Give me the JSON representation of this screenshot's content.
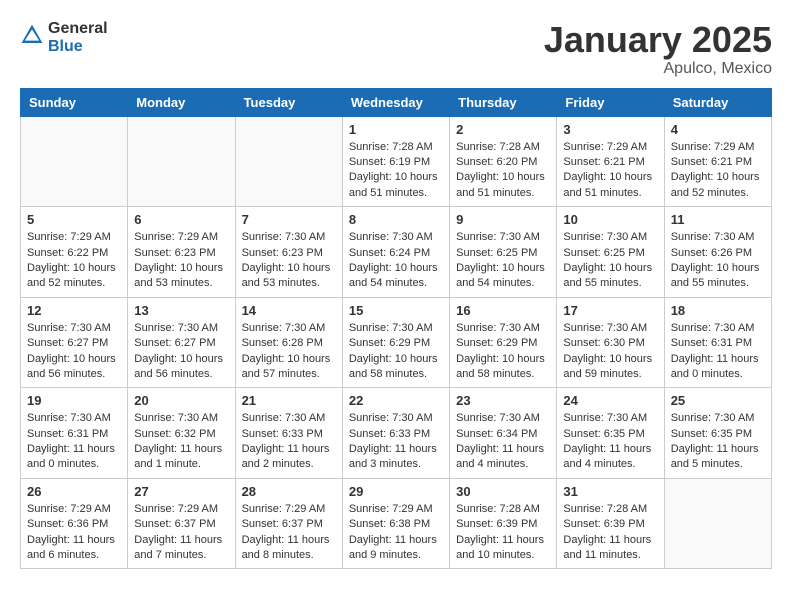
{
  "header": {
    "logo_general": "General",
    "logo_blue": "Blue",
    "title": "January 2025",
    "subtitle": "Apulco, Mexico"
  },
  "days_of_week": [
    "Sunday",
    "Monday",
    "Tuesday",
    "Wednesday",
    "Thursday",
    "Friday",
    "Saturday"
  ],
  "weeks": [
    [
      {
        "day": "",
        "sunrise": "",
        "sunset": "",
        "daylight": ""
      },
      {
        "day": "",
        "sunrise": "",
        "sunset": "",
        "daylight": ""
      },
      {
        "day": "",
        "sunrise": "",
        "sunset": "",
        "daylight": ""
      },
      {
        "day": "1",
        "sunrise": "Sunrise: 7:28 AM",
        "sunset": "Sunset: 6:19 PM",
        "daylight": "Daylight: 10 hours and 51 minutes."
      },
      {
        "day": "2",
        "sunrise": "Sunrise: 7:28 AM",
        "sunset": "Sunset: 6:20 PM",
        "daylight": "Daylight: 10 hours and 51 minutes."
      },
      {
        "day": "3",
        "sunrise": "Sunrise: 7:29 AM",
        "sunset": "Sunset: 6:21 PM",
        "daylight": "Daylight: 10 hours and 51 minutes."
      },
      {
        "day": "4",
        "sunrise": "Sunrise: 7:29 AM",
        "sunset": "Sunset: 6:21 PM",
        "daylight": "Daylight: 10 hours and 52 minutes."
      }
    ],
    [
      {
        "day": "5",
        "sunrise": "Sunrise: 7:29 AM",
        "sunset": "Sunset: 6:22 PM",
        "daylight": "Daylight: 10 hours and 52 minutes."
      },
      {
        "day": "6",
        "sunrise": "Sunrise: 7:29 AM",
        "sunset": "Sunset: 6:23 PM",
        "daylight": "Daylight: 10 hours and 53 minutes."
      },
      {
        "day": "7",
        "sunrise": "Sunrise: 7:30 AM",
        "sunset": "Sunset: 6:23 PM",
        "daylight": "Daylight: 10 hours and 53 minutes."
      },
      {
        "day": "8",
        "sunrise": "Sunrise: 7:30 AM",
        "sunset": "Sunset: 6:24 PM",
        "daylight": "Daylight: 10 hours and 54 minutes."
      },
      {
        "day": "9",
        "sunrise": "Sunrise: 7:30 AM",
        "sunset": "Sunset: 6:25 PM",
        "daylight": "Daylight: 10 hours and 54 minutes."
      },
      {
        "day": "10",
        "sunrise": "Sunrise: 7:30 AM",
        "sunset": "Sunset: 6:25 PM",
        "daylight": "Daylight: 10 hours and 55 minutes."
      },
      {
        "day": "11",
        "sunrise": "Sunrise: 7:30 AM",
        "sunset": "Sunset: 6:26 PM",
        "daylight": "Daylight: 10 hours and 55 minutes."
      }
    ],
    [
      {
        "day": "12",
        "sunrise": "Sunrise: 7:30 AM",
        "sunset": "Sunset: 6:27 PM",
        "daylight": "Daylight: 10 hours and 56 minutes."
      },
      {
        "day": "13",
        "sunrise": "Sunrise: 7:30 AM",
        "sunset": "Sunset: 6:27 PM",
        "daylight": "Daylight: 10 hours and 56 minutes."
      },
      {
        "day": "14",
        "sunrise": "Sunrise: 7:30 AM",
        "sunset": "Sunset: 6:28 PM",
        "daylight": "Daylight: 10 hours and 57 minutes."
      },
      {
        "day": "15",
        "sunrise": "Sunrise: 7:30 AM",
        "sunset": "Sunset: 6:29 PM",
        "daylight": "Daylight: 10 hours and 58 minutes."
      },
      {
        "day": "16",
        "sunrise": "Sunrise: 7:30 AM",
        "sunset": "Sunset: 6:29 PM",
        "daylight": "Daylight: 10 hours and 58 minutes."
      },
      {
        "day": "17",
        "sunrise": "Sunrise: 7:30 AM",
        "sunset": "Sunset: 6:30 PM",
        "daylight": "Daylight: 10 hours and 59 minutes."
      },
      {
        "day": "18",
        "sunrise": "Sunrise: 7:30 AM",
        "sunset": "Sunset: 6:31 PM",
        "daylight": "Daylight: 11 hours and 0 minutes."
      }
    ],
    [
      {
        "day": "19",
        "sunrise": "Sunrise: 7:30 AM",
        "sunset": "Sunset: 6:31 PM",
        "daylight": "Daylight: 11 hours and 0 minutes."
      },
      {
        "day": "20",
        "sunrise": "Sunrise: 7:30 AM",
        "sunset": "Sunset: 6:32 PM",
        "daylight": "Daylight: 11 hours and 1 minute."
      },
      {
        "day": "21",
        "sunrise": "Sunrise: 7:30 AM",
        "sunset": "Sunset: 6:33 PM",
        "daylight": "Daylight: 11 hours and 2 minutes."
      },
      {
        "day": "22",
        "sunrise": "Sunrise: 7:30 AM",
        "sunset": "Sunset: 6:33 PM",
        "daylight": "Daylight: 11 hours and 3 minutes."
      },
      {
        "day": "23",
        "sunrise": "Sunrise: 7:30 AM",
        "sunset": "Sunset: 6:34 PM",
        "daylight": "Daylight: 11 hours and 4 minutes."
      },
      {
        "day": "24",
        "sunrise": "Sunrise: 7:30 AM",
        "sunset": "Sunset: 6:35 PM",
        "daylight": "Daylight: 11 hours and 4 minutes."
      },
      {
        "day": "25",
        "sunrise": "Sunrise: 7:30 AM",
        "sunset": "Sunset: 6:35 PM",
        "daylight": "Daylight: 11 hours and 5 minutes."
      }
    ],
    [
      {
        "day": "26",
        "sunrise": "Sunrise: 7:29 AM",
        "sunset": "Sunset: 6:36 PM",
        "daylight": "Daylight: 11 hours and 6 minutes."
      },
      {
        "day": "27",
        "sunrise": "Sunrise: 7:29 AM",
        "sunset": "Sunset: 6:37 PM",
        "daylight": "Daylight: 11 hours and 7 minutes."
      },
      {
        "day": "28",
        "sunrise": "Sunrise: 7:29 AM",
        "sunset": "Sunset: 6:37 PM",
        "daylight": "Daylight: 11 hours and 8 minutes."
      },
      {
        "day": "29",
        "sunrise": "Sunrise: 7:29 AM",
        "sunset": "Sunset: 6:38 PM",
        "daylight": "Daylight: 11 hours and 9 minutes."
      },
      {
        "day": "30",
        "sunrise": "Sunrise: 7:28 AM",
        "sunset": "Sunset: 6:39 PM",
        "daylight": "Daylight: 11 hours and 10 minutes."
      },
      {
        "day": "31",
        "sunrise": "Sunrise: 7:28 AM",
        "sunset": "Sunset: 6:39 PM",
        "daylight": "Daylight: 11 hours and 11 minutes."
      },
      {
        "day": "",
        "sunrise": "",
        "sunset": "",
        "daylight": ""
      }
    ]
  ]
}
